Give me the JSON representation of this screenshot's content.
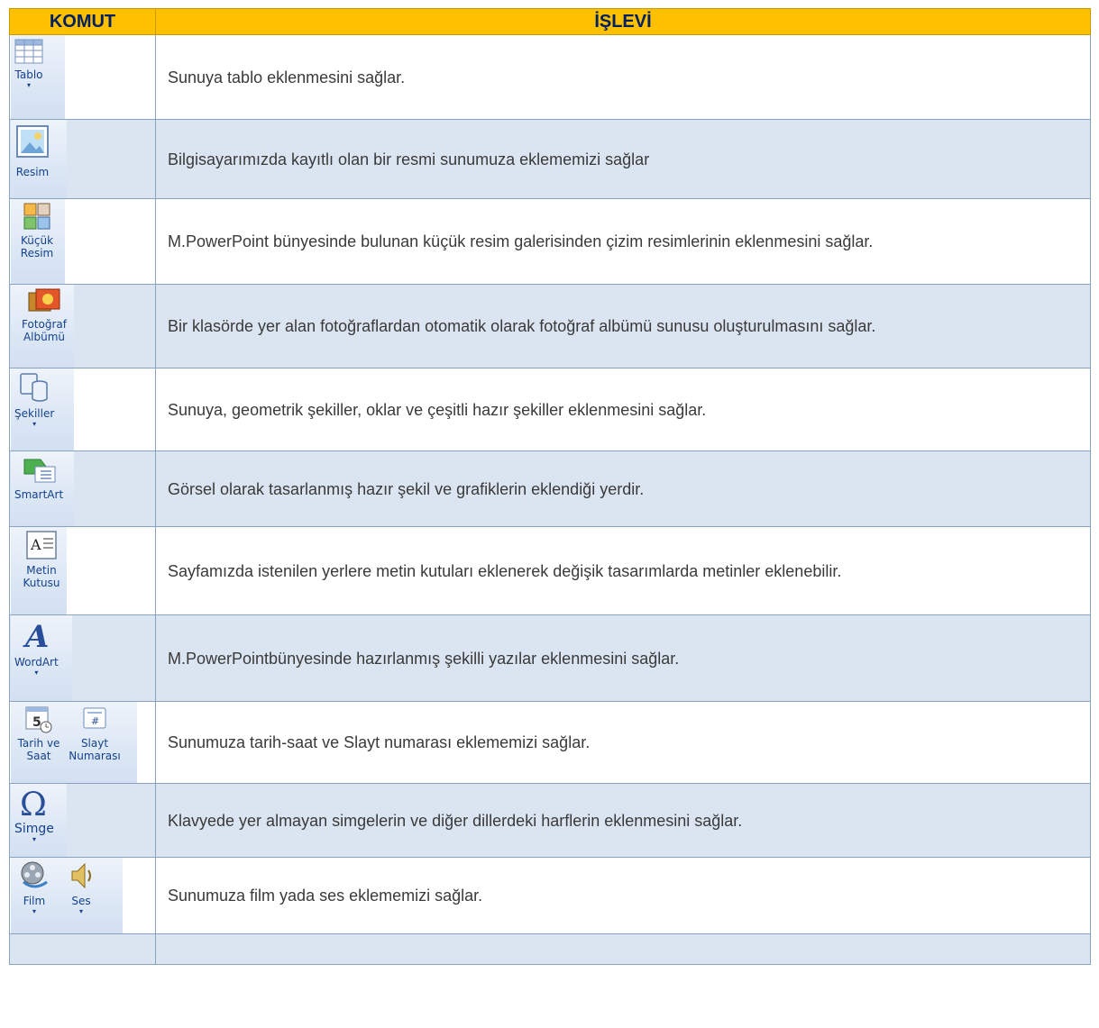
{
  "header": {
    "command": "KOMUT",
    "function": "İŞLEVİ"
  },
  "rows": [
    {
      "buttons": [
        {
          "icon": "table-icon",
          "label": "Tablo"
        }
      ],
      "description": "Sunuya tablo eklenmesini sağlar."
    },
    {
      "buttons": [
        {
          "icon": "picture-icon",
          "label": "Resim"
        }
      ],
      "description": "Bilgisayarımızda kayıtlı olan bir resmi sunumuza  eklememizi sağlar"
    },
    {
      "buttons": [
        {
          "icon": "clipart-icon",
          "label": "Küçük Resim"
        }
      ],
      "description": "M.PowerPoint bünyesinde bulunan küçük resim galerisinden çizim resimlerinin eklenmesini sağlar."
    },
    {
      "buttons": [
        {
          "icon": "photo-album-icon",
          "label": "Fotoğraf Albümü"
        }
      ],
      "description": "Bir klasörde yer alan fotoğraflardan otomatik olarak fotoğraf albümü sunusu oluşturulmasını sağlar."
    },
    {
      "buttons": [
        {
          "icon": "shapes-icon",
          "label": "Şekiller"
        }
      ],
      "description": "Sunuya, geometrik şekiller, oklar ve çeşitli hazır şekiller eklenmesini sağlar."
    },
    {
      "buttons": [
        {
          "icon": "smartart-icon",
          "label": "SmartArt"
        }
      ],
      "description": "Görsel olarak tasarlanmış hazır şekil ve grafiklerin eklendiği yerdir."
    },
    {
      "buttons": [
        {
          "icon": "text-box-icon",
          "label": "Metin Kutusu"
        }
      ],
      "description": "Sayfamızda istenilen yerlere metin kutuları eklenerek değişik tasarımlarda metinler eklenebilir."
    },
    {
      "buttons": [
        {
          "icon": "wordart-icon",
          "label": "WordArt"
        }
      ],
      "description": "M.PowerPointbünyesinde hazırlanmış şekilli yazılar eklenmesini sağlar."
    },
    {
      "buttons": [
        {
          "icon": "date-time-icon",
          "label": "Tarih ve Saat"
        },
        {
          "icon": "slide-number-icon",
          "label": "Slayt Numarası"
        }
      ],
      "description": "Sunumuza tarih-saat ve Slayt numarası eklememizi sağlar."
    },
    {
      "buttons": [
        {
          "icon": "omega-symbol-icon",
          "label": "Simge"
        }
      ],
      "description": "Klavyede yer almayan simgelerin ve diğer dillerdeki harflerin eklenmesini sağlar."
    },
    {
      "buttons": [
        {
          "icon": "film-reel-icon",
          "label": "Film"
        },
        {
          "icon": "speaker-icon",
          "label": "Ses"
        }
      ],
      "description": "Sunumuza film yada ses eklememizi sağlar."
    }
  ],
  "colors": {
    "header_bg": "#ffc000",
    "header_text": "#002060",
    "row_alt_bg": "#dbe5f1",
    "border": "#8aa2c2"
  }
}
